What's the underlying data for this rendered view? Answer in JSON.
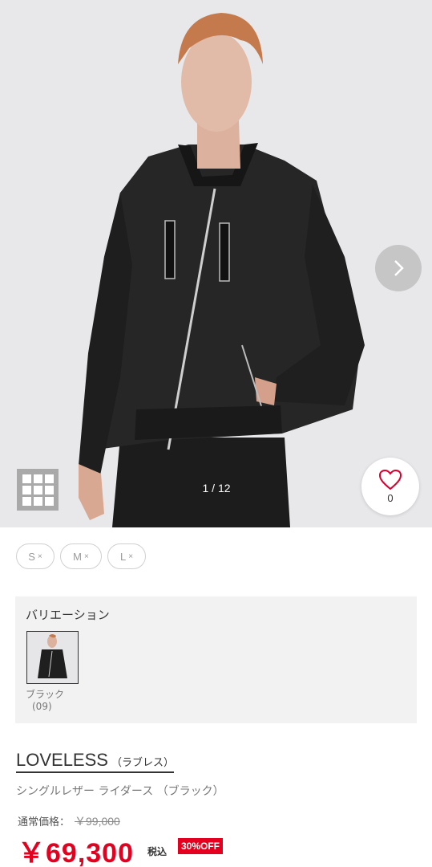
{
  "gallery": {
    "counter": "1 / 12",
    "favorite_count": "0",
    "icons": {
      "next": "chevron-right-icon",
      "grid": "grid-icon",
      "favorite": "heart-icon"
    }
  },
  "sizes": [
    {
      "label": "S",
      "mark": "×"
    },
    {
      "label": "M",
      "mark": "×"
    },
    {
      "label": "L",
      "mark": "×"
    }
  ],
  "variation": {
    "title": "バリエーション",
    "color_name": "ブラック",
    "color_code": "(09)"
  },
  "product": {
    "brand": "LOVELESS",
    "brand_kana": "（ラブレス）",
    "name": "シングルレザー ライダース （ブラック）"
  },
  "pricing": {
    "regular_label": "通常価格：",
    "regular_price": "￥99,000",
    "sale_price": "￥69,300",
    "tax_label": "税込",
    "discount_badge": "30%OFF",
    "accent_color": "#e4001e"
  }
}
